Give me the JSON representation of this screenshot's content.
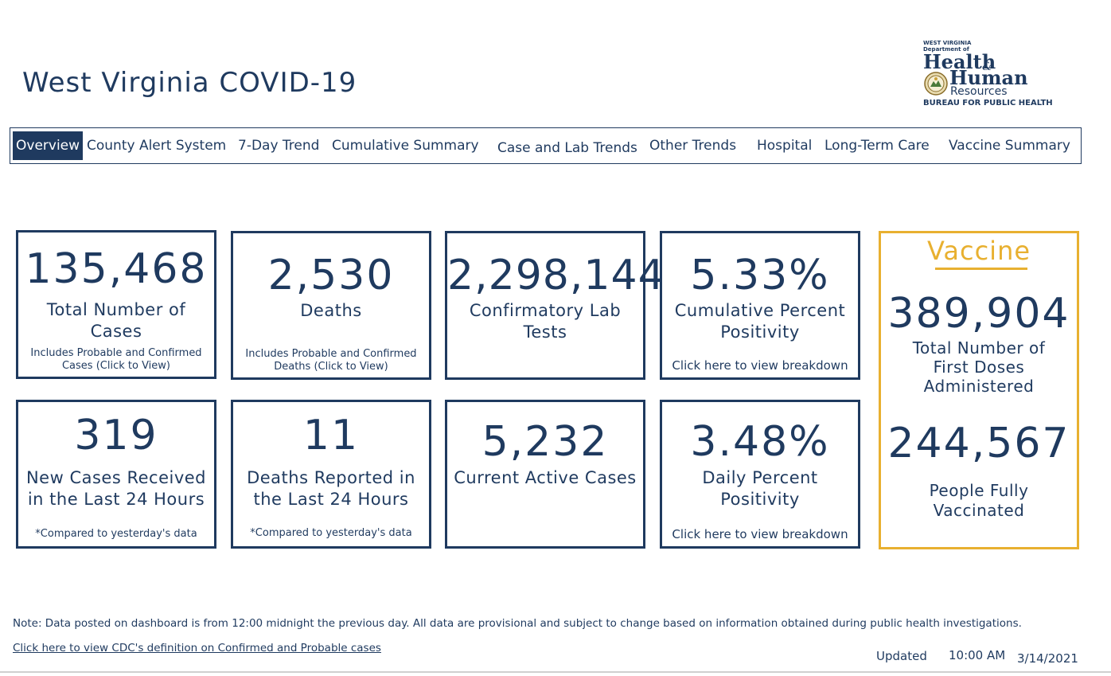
{
  "header": {
    "title": "West Virginia COVID-19",
    "logo": {
      "line1": "WEST VIRGINIA",
      "line2": "Department of",
      "health": "Health",
      "amp": "&",
      "human": "Human",
      "resources": "Resources",
      "bureau": "BUREAU FOR PUBLIC HEALTH"
    }
  },
  "nav": {
    "tabs": [
      {
        "label": "Overview",
        "active": true
      },
      {
        "label": "County Alert System"
      },
      {
        "label": "7-Day Trend"
      },
      {
        "label": "Cumulative Summary"
      },
      {
        "label": "Case and Lab Trends"
      },
      {
        "label": "Other Trends"
      },
      {
        "label": "Hospital"
      },
      {
        "label": "Long-Term Care"
      },
      {
        "label": "Vaccine Summary"
      }
    ]
  },
  "cards": {
    "total_cases": {
      "value": "135,468",
      "label": "Total Number of Cases",
      "note": "Includes Probable and Confirmed Cases (Click to View)"
    },
    "deaths": {
      "value": "2,530",
      "label": "Deaths",
      "note": "Includes Probable and Confirmed Deaths (Click to View)"
    },
    "lab_tests": {
      "value": "2,298,144",
      "label": "Confirmatory Lab Tests"
    },
    "cumulative_positivity": {
      "value": "5.33%",
      "label": "Cumulative Percent Positivity",
      "note": "Click here to view breakdown"
    },
    "new_cases": {
      "value": "319",
      "label": "New Cases Received in the Last 24 Hours",
      "note": "*Compared to yesterday's data"
    },
    "new_deaths": {
      "value": "11",
      "label": "Deaths Reported in the Last 24 Hours",
      "note": "*Compared to yesterday's data"
    },
    "active_cases": {
      "value": "5,232",
      "label": "Current Active Cases"
    },
    "daily_positivity": {
      "value": "3.48%",
      "label": "Daily Percent Positivity",
      "note": "Click here to view breakdown"
    }
  },
  "vaccine": {
    "heading": "Vaccine",
    "first_doses": {
      "value": "389,904",
      "label": "Total Number of First Doses Administered"
    },
    "fully_vaccinated": {
      "value": "244,567",
      "label": "People Fully Vaccinated"
    }
  },
  "footer": {
    "note": "Note: Data posted on dashboard is from 12:00 midnight the previous day. All data are provisional and subject to change based on information obtained during public health investigations.",
    "cdc_link": "Click here to view CDC's definition on Confirmed and Probable cases",
    "updated_label": "Updated",
    "updated_time": "10:00 AM",
    "updated_date": "3/14/2021"
  },
  "colors": {
    "primary": "#1f3a5f",
    "vaccine_accent": "#e8b030"
  },
  "icons": {
    "logo_seal": "wv-state-seal"
  }
}
